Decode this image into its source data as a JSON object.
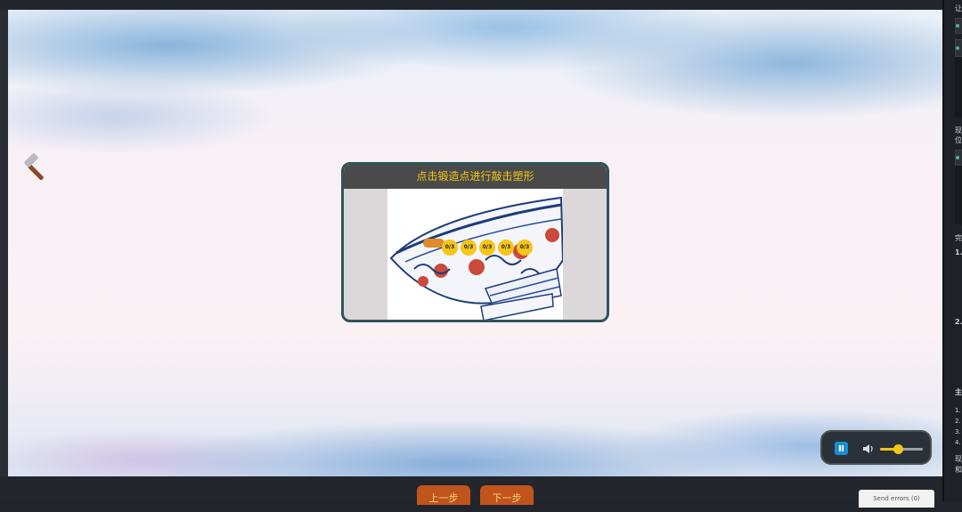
{
  "dialog": {
    "title": "点击锻造点进行敲击塑形",
    "markers": [
      "0/3",
      "0/3",
      "0/3",
      "0/3",
      "0/3"
    ]
  },
  "audio": {
    "state": "playing",
    "volume_fraction": 0.42
  },
  "navigation": {
    "prev_label": "上一步",
    "next_label": "下一步"
  },
  "send_errors_label": "Send errors (0)",
  "right_panel": {
    "lines": [
      "让",
      "现",
      "位",
      "完",
      "1.",
      "2.",
      "主",
      "1.",
      "2.",
      "3.",
      "4.",
      "现",
      "和"
    ]
  },
  "colors": {
    "accent": "#f5c518",
    "button": "#c0541b",
    "dialog_border": "#2f5559",
    "dialog_header": "#4a4a4a"
  },
  "icons": [
    "hammer-icon",
    "pause-icon",
    "speaker-icon"
  ]
}
